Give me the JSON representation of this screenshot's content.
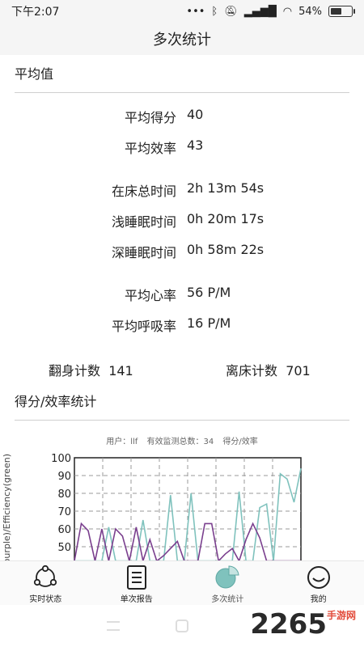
{
  "status": {
    "time": "下午2:07",
    "dots": "...",
    "battery_text": "54%",
    "battery_level": 0.54
  },
  "title": "多次统计",
  "average": {
    "section_title": "平均值",
    "score": {
      "label": "平均得分",
      "value": "40"
    },
    "efficiency": {
      "label": "平均效率",
      "value": "43"
    },
    "bed_time": {
      "label": "在床总时间",
      "value": "2h 13m 54s"
    },
    "light_sleep": {
      "label": "浅睡眠时间",
      "value": "0h 20m 17s"
    },
    "deep_sleep": {
      "label": "深睡眠时间",
      "value": "0h 58m 22s"
    },
    "heart_rate": {
      "label": "平均心率",
      "value": "56 P/M"
    },
    "breath_rate": {
      "label": "平均呼吸率",
      "value": "16 P/M"
    },
    "turn_count": {
      "label": "翻身计数",
      "value": "141"
    },
    "leave_count": {
      "label": "离床计数",
      "value": "701"
    }
  },
  "score_section": {
    "section_title": "得分/效率统计",
    "caption_user": "用户：llf",
    "caption_total": "有效监测总数：34",
    "caption_kind": "得分/效率"
  },
  "chart_data": {
    "type": "line",
    "title": "",
    "ylabel": "Score(purple)/Efficiency(green)",
    "xlabel": "",
    "ylim": [
      40,
      100
    ],
    "yticks": [
      "100",
      "90",
      "80",
      "70",
      "60",
      "50"
    ],
    "grid": true,
    "series": [
      {
        "name": "Score(purple)",
        "color": "#7a3f8e",
        "values": [
          42,
          63,
          59,
          42,
          60,
          42,
          60,
          56,
          42,
          61,
          42,
          54,
          42,
          45,
          49,
          53,
          42,
          42,
          42,
          63,
          63,
          42,
          46,
          49,
          42,
          54,
          63,
          55,
          42,
          42,
          42,
          42,
          42,
          42
        ]
      },
      {
        "name": "Efficiency(green)",
        "color": "#7fc2bd",
        "values": [
          42,
          42,
          42,
          42,
          42,
          61,
          42,
          42,
          42,
          42,
          65,
          42,
          42,
          42,
          79,
          42,
          42,
          80,
          42,
          42,
          42,
          42,
          42,
          42,
          81,
          42,
          42,
          72,
          74,
          42,
          91,
          88,
          75,
          94
        ]
      }
    ]
  },
  "nav": {
    "realtime": "实时状态",
    "single": "单次报告",
    "multi": "多次统计",
    "mine": "我的"
  },
  "watermark": {
    "main": "2265",
    "sub": "手游网"
  }
}
